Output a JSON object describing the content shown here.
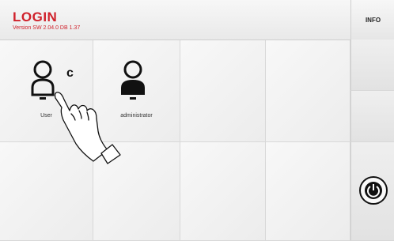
{
  "header": {
    "title": "LOGIN",
    "version": "Version SW 2.04.0 DB 1.37",
    "info_label": "INFO"
  },
  "users": [
    {
      "label": "User",
      "icon": "user-outline-icon",
      "badge": "c"
    },
    {
      "label": "administrator",
      "icon": "user-filled-icon"
    }
  ],
  "side": {
    "power_icon": "power-icon"
  },
  "colors": {
    "accent": "#d0212b",
    "tile": "#f2f2f2"
  }
}
